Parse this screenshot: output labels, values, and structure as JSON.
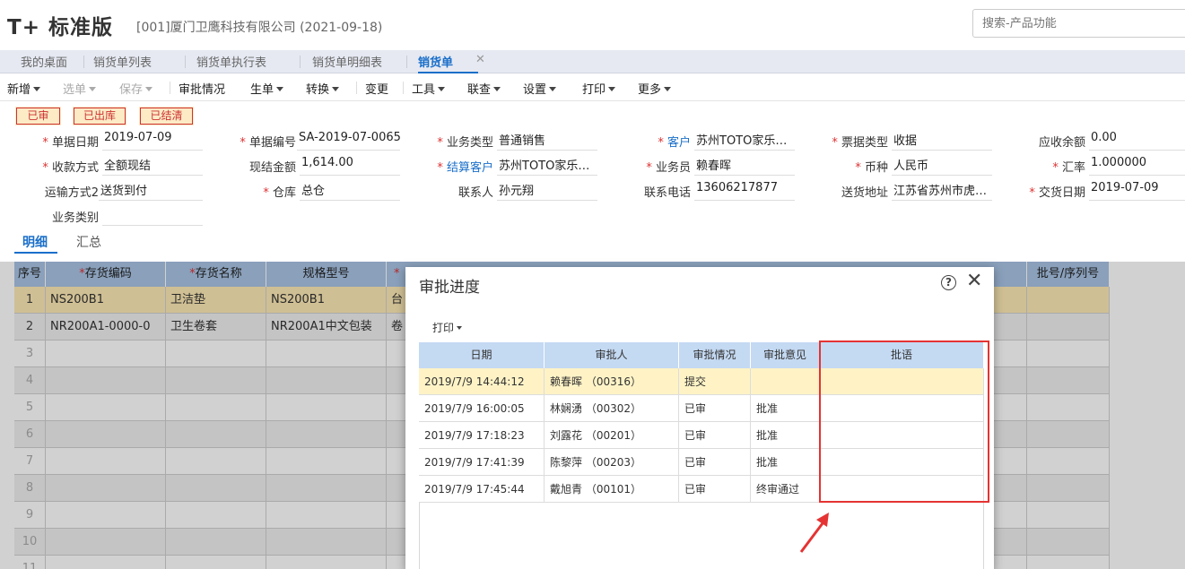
{
  "header": {
    "logo": "T+ 标准版",
    "company": "[001]厦门卫鹰科技有限公司   (2021-09-18)",
    "search_placeholder": "搜索-产品功能"
  },
  "tabs": [
    "我的桌面",
    "销货单列表",
    "销货单执行表",
    "销货单明细表",
    "销货单"
  ],
  "tab_close": "✕",
  "toolbar": [
    "新增",
    "选单",
    "保存",
    "审批情况",
    "生单",
    "转换",
    "变更",
    "工具",
    "联查",
    "设置",
    "打印",
    "更多"
  ],
  "stamps": [
    "已审",
    "已出库",
    "已结清"
  ],
  "form": {
    "date_label": "单据日期",
    "date": "2019-07-09",
    "code_label": "单据编号",
    "code": "SA-2019-07-0065",
    "biztype_label": "业务类型",
    "biztype": "普通销售",
    "customer_label": "客户",
    "customer": "苏州TOTO家乐…",
    "invoicetype_label": "票据类型",
    "invoicetype": "收据",
    "receivable_label": "应收余额",
    "receivable": "0.00",
    "paymethod_label": "收款方式",
    "paymethod": "全额现结",
    "cash_label": "现结金额",
    "cash": "1,614.00",
    "settle_label": "结算客户",
    "settle": "苏州TOTO家乐…",
    "salesman_label": "业务员",
    "salesman": "赖春晖",
    "currency_label": "币种",
    "currency": "人民币",
    "rate_label": "汇率",
    "rate": "1.000000",
    "transport_label": "运输方式2",
    "transport": "送货到付",
    "warehouse_label": "仓库",
    "warehouse": "总仓",
    "contact_label": "联系人",
    "contact": "孙元翔",
    "phone_label": "联系电话",
    "phone": "13606217877",
    "address_label": "送货地址",
    "address": "江苏省苏州市虎…",
    "delivery_label": "交货日期",
    "delivery": "2019-07-09",
    "category_label": "业务类别",
    "category": ""
  },
  "subtabs": [
    "明细",
    "汇总"
  ],
  "grid": {
    "headers": [
      "序号",
      "存货编码",
      "存货名称",
      "规格型号",
      "批号/序列号"
    ],
    "rows": [
      {
        "idx": "1",
        "code": "NS200B1",
        "name": "卫洁垫",
        "spec": "NS200B1",
        "unit": "台"
      },
      {
        "idx": "2",
        "code": "NR200A1-0000-0",
        "name": "卫生卷套",
        "spec": "NR200A1中文包装",
        "unit": "卷"
      }
    ],
    "empty_idx": [
      "3",
      "4",
      "5",
      "6",
      "7",
      "8",
      "9",
      "10",
      "11"
    ]
  },
  "dialog": {
    "title": "审批进度",
    "print_label": "打印",
    "headers": [
      "日期",
      "审批人",
      "审批情况",
      "审批意见",
      "批语"
    ],
    "rows": [
      {
        "date": "2019/7/9 14:44:12",
        "approver": "赖春晖 （00316）",
        "status": "提交",
        "opinion": "",
        "comment": ""
      },
      {
        "date": "2019/7/9 16:00:05",
        "approver": "林娴湧 （00302）",
        "status": "已审",
        "opinion": "批准",
        "comment": ""
      },
      {
        "date": "2019/7/9 17:18:23",
        "approver": "刘露花 （00201）",
        "status": "已审",
        "opinion": "批准",
        "comment": ""
      },
      {
        "date": "2019/7/9 17:41:39",
        "approver": "陈黎萍 （00203）",
        "status": "已审",
        "opinion": "批准",
        "comment": ""
      },
      {
        "date": "2019/7/9 17:45:44",
        "approver": "戴旭青 （00101）",
        "status": "已审",
        "opinion": "终审通过",
        "comment": ""
      }
    ]
  },
  "colors": {
    "accent": "#1a6fc9",
    "highlight": "#e53333",
    "selected_row": "#fff3c6"
  }
}
